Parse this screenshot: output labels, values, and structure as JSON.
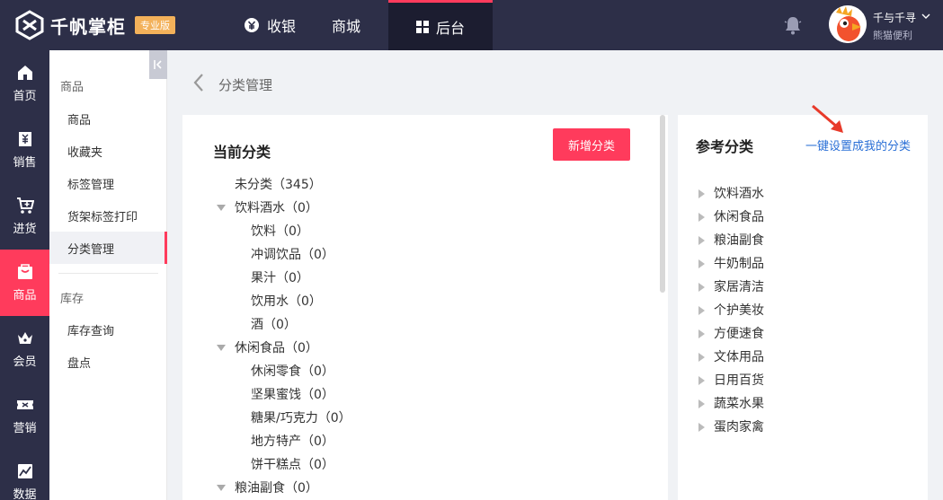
{
  "header": {
    "logo_text": "千帆掌柜",
    "edition": "专业版",
    "tabs": [
      {
        "label": "收银",
        "icon": "yen-icon"
      },
      {
        "label": "商城",
        "icon": ""
      },
      {
        "label": "后台",
        "icon": "grid-icon",
        "active": true
      }
    ],
    "user": {
      "name": "千与千寻",
      "store": "熊猫便利"
    },
    "colors": {
      "bar": "#2d2f48",
      "accent": "#ff3b5c",
      "badge": "#f3b15a"
    }
  },
  "leftnav": {
    "items": [
      {
        "label": "首页",
        "icon": "home-icon"
      },
      {
        "label": "销售",
        "icon": "sales-icon"
      },
      {
        "label": "进货",
        "icon": "cart-icon"
      },
      {
        "label": "商品",
        "icon": "goods-icon",
        "active": true
      },
      {
        "label": "会员",
        "icon": "crown-icon"
      },
      {
        "label": "营销",
        "icon": "ticket-icon"
      },
      {
        "label": "数据",
        "icon": "chart-icon"
      }
    ]
  },
  "subnav": {
    "group1": "商品",
    "items1": [
      "商品",
      "收藏夹",
      "标签管理",
      "货架标签打印",
      "分类管理"
    ],
    "active_item": "分类管理",
    "group2": "库存",
    "items2": [
      "库存查询",
      "盘点"
    ]
  },
  "breadcrumb": {
    "title": "分类管理"
  },
  "current": {
    "title": "当前分类",
    "add_button": "新增分类",
    "rows": [
      {
        "text": "未分类（345）",
        "level": 0,
        "expanded": false,
        "has_caret": false
      },
      {
        "text": "饮料酒水（0）",
        "level": 0,
        "expanded": true,
        "has_caret": true
      },
      {
        "text": "饮料（0）",
        "level": 1
      },
      {
        "text": "冲调饮品（0）",
        "level": 1
      },
      {
        "text": "果汁（0）",
        "level": 1
      },
      {
        "text": "饮用水（0）",
        "level": 1
      },
      {
        "text": "酒（0）",
        "level": 1
      },
      {
        "text": "休闲食品（0）",
        "level": 0,
        "expanded": true,
        "has_caret": true
      },
      {
        "text": "休闲零食（0）",
        "level": 1
      },
      {
        "text": "坚果蜜饯（0）",
        "level": 1
      },
      {
        "text": "糖果/巧克力（0）",
        "level": 1
      },
      {
        "text": "地方特产（0）",
        "level": 1
      },
      {
        "text": "饼干糕点（0）",
        "level": 1
      },
      {
        "text": "粮油副食（0）",
        "level": 0,
        "expanded": true,
        "has_caret": true
      }
    ]
  },
  "reference": {
    "title": "参考分类",
    "link": "一键设置成我的分类",
    "items": [
      "饮料酒水",
      "休闲食品",
      "粮油副食",
      "牛奶制品",
      "家居清洁",
      "个护美妆",
      "方便速食",
      "文体用品",
      "日用百货",
      "蔬菜水果",
      "蛋肉家禽"
    ]
  }
}
